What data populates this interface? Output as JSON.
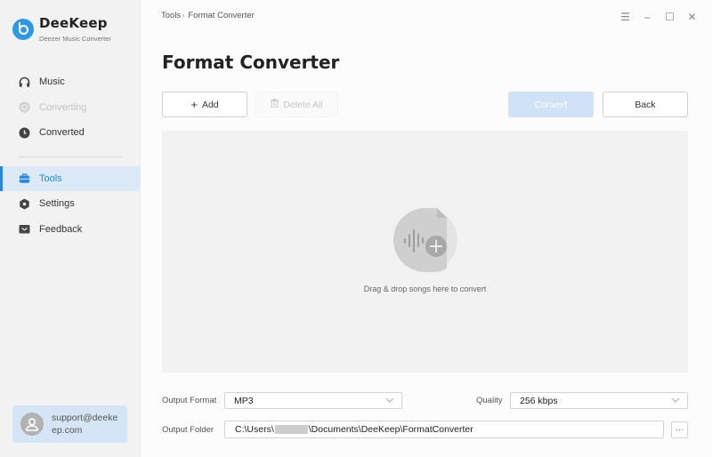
{
  "app": {
    "name": "DeeKeep",
    "subtitle": "Deezer Music Converter",
    "brand_color": "#2f98e6",
    "accent_color": "#2c86e0"
  },
  "sidebar": {
    "items": [
      {
        "label": "Music",
        "icon": "headphones-icon",
        "state": "normal"
      },
      {
        "label": "Converting",
        "icon": "converting-icon",
        "state": "disabled"
      },
      {
        "label": "Converted",
        "icon": "clock-icon",
        "state": "normal"
      },
      {
        "label": "Tools",
        "icon": "toolbox-icon",
        "state": "active"
      },
      {
        "label": "Settings",
        "icon": "gear-icon",
        "state": "normal"
      },
      {
        "label": "Feedback",
        "icon": "mail-icon",
        "state": "normal"
      }
    ],
    "support_email": "support@deekeep.com"
  },
  "header": {
    "breadcrumb": {
      "parent": "Tools",
      "separator": "›",
      "current": "Format Converter"
    },
    "window_controls": {
      "menu": "☰",
      "minimize": "–",
      "maximize": "☐",
      "close": "✕"
    }
  },
  "main": {
    "title": "Format Converter",
    "toolbar": {
      "add_label": "Add",
      "delete_all_label": "Delete All",
      "convert_label": "Convert",
      "back_label": "Back"
    },
    "dropzone": {
      "text": "Drag & drop songs here to convert"
    },
    "settings": {
      "output_format_label": "Output Format",
      "output_format_value": "MP3",
      "quality_label": "Quality",
      "quality_value": "256 kbps",
      "output_folder_label": "Output Folder",
      "output_folder_prefix": "C:\\Users\\",
      "output_folder_suffix": "\\Documents\\DeeKeep\\FormatConverter",
      "browse_label": "···"
    }
  }
}
